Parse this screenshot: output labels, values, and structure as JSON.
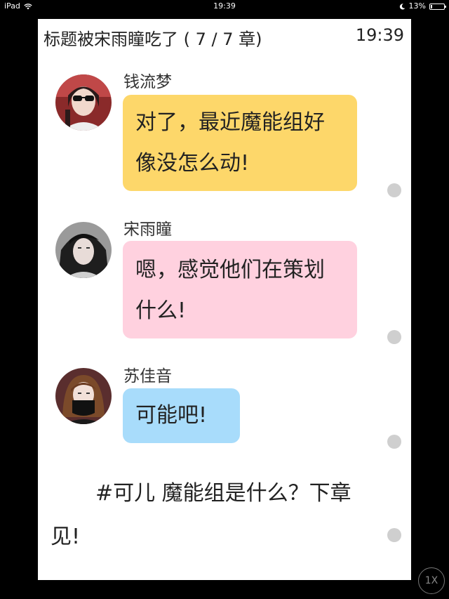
{
  "status_bar": {
    "device": "iPad",
    "time": "19:39",
    "battery": "13%",
    "battery_level": 0.13,
    "icons": [
      "wifi-icon",
      "moon-icon",
      "battery-icon"
    ]
  },
  "header": {
    "title": "标题被宋雨瞳吃了 ( 7 / 7 章)",
    "clock": "19:39"
  },
  "messages": [
    {
      "sender": "钱流梦",
      "text": "对了，最近魔能组好像没怎么动!",
      "bubble_color": "#fdd76a",
      "avatar_icon": "avatar-qian-liumeng"
    },
    {
      "sender": "宋雨瞳",
      "text": "嗯，感觉他们在策划什么!",
      "bubble_color": "#ffd1df",
      "avatar_icon": "avatar-song-yutong"
    },
    {
      "sender": "苏佳音",
      "text": "可能吧!",
      "bubble_color": "#a8dcfb",
      "avatar_icon": "avatar-su-jiayin"
    }
  ],
  "narration": "#可儿 魔能组是什么？下章见!",
  "playback_speed": "1X"
}
